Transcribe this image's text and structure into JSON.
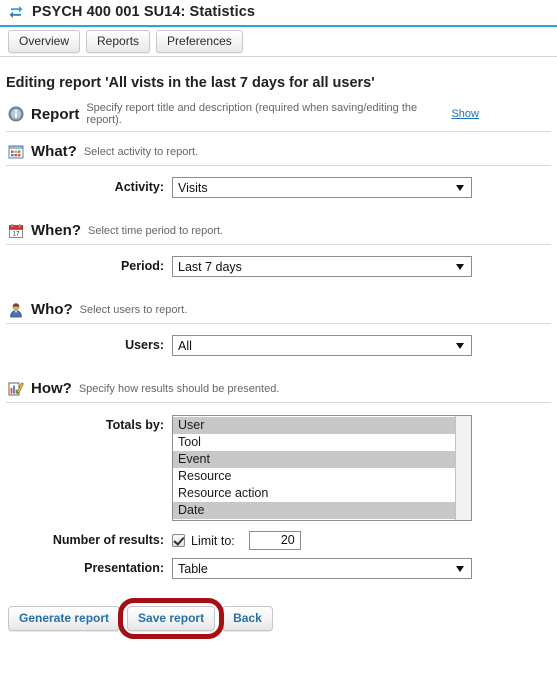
{
  "titlebar": {
    "icon": "sync-arrows-icon",
    "title": "PSYCH 400 001 SU14: Statistics",
    "accent_color": "#2ba6d4"
  },
  "tabs": [
    {
      "label": "Overview"
    },
    {
      "label": "Reports"
    },
    {
      "label": "Preferences"
    }
  ],
  "page": {
    "heading": "Editing report 'All vists in the last 7 days for all users'"
  },
  "sections": {
    "report": {
      "icon": "info-icon",
      "title": "Report",
      "description": "Specify report title and description (required when saving/editing the report).",
      "link": "Show"
    },
    "what": {
      "icon": "window-grid-icon",
      "title": "What?",
      "description": "Select activity to report.",
      "activity_label": "Activity:",
      "activity_value": "Visits"
    },
    "when": {
      "icon": "calendar-icon",
      "title": "When?",
      "description": "Select time period to report.",
      "period_label": "Period:",
      "period_value": "Last 7 days"
    },
    "who": {
      "icon": "user-icon",
      "title": "Who?",
      "description": "Select users to report.",
      "users_label": "Users:",
      "users_value": "All"
    },
    "how": {
      "icon": "chart-pencil-icon",
      "title": "How?",
      "description": "Specify how results should be presented.",
      "totals_label": "Totals by:",
      "totals_options": [
        {
          "label": "User",
          "selected": true
        },
        {
          "label": "Tool",
          "selected": false
        },
        {
          "label": "Event",
          "selected": true
        },
        {
          "label": "Resource",
          "selected": false
        },
        {
          "label": "Resource action",
          "selected": false
        },
        {
          "label": "Date",
          "selected": true
        }
      ],
      "results_label": "Number of results:",
      "limit_checked": true,
      "limit_label": "Limit to:",
      "limit_value": "20",
      "presentation_label": "Presentation:",
      "presentation_value": "Table"
    }
  },
  "actions": {
    "generate": "Generate report",
    "save": "Save report",
    "back": "Back",
    "highlighted": "save",
    "highlight_color": "#a50f14"
  }
}
